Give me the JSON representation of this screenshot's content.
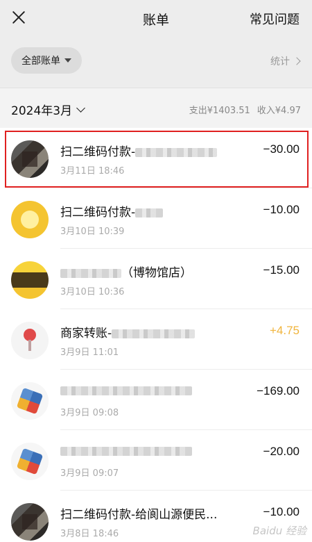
{
  "navbar": {
    "title": "账单",
    "faq_label": "常见问题"
  },
  "filter": {
    "chip_label": "全部账单",
    "stats_label": "统计"
  },
  "month": {
    "label": "2024年3月",
    "expense": "支出¥1403.51",
    "income": "收入¥4.97"
  },
  "transactions": [
    {
      "title": "扫二维码付款-",
      "time": "3月11日 18:46",
      "amount": "−30.00",
      "type": "expense",
      "avatar": "photo-avatar"
    },
    {
      "title": "扫二维码付款-",
      "time": "3月10日 10:39",
      "amount": "−10.00",
      "type": "expense",
      "avatar": "yellow-avatar"
    },
    {
      "title": "（博物馆店）",
      "time": "3月10日 10:36",
      "amount": "−15.00",
      "type": "expense",
      "avatar": "gold-avatar"
    },
    {
      "title": "商家转账-",
      "time": "3月9日 11:01",
      "amount": "+4.75",
      "type": "income",
      "avatar": "pin-avatar"
    },
    {
      "title": "",
      "time": "3月9日 09:08",
      "amount": "−169.00",
      "type": "expense",
      "avatar": "multi-avatar"
    },
    {
      "title": "",
      "time": "3月9日 09:07",
      "amount": "−20.00",
      "type": "expense",
      "avatar": "multi-avatar"
    },
    {
      "title": "扫二维码付款-给阆山源便民...",
      "time": "3月8日 18:46",
      "amount": "−10.00",
      "type": "expense",
      "avatar": "photo-avatar"
    }
  ],
  "colors": {
    "accent_income": "#f0b43c",
    "highlight_border": "#e02020",
    "header_bg": "#ededed"
  },
  "watermark": "Baidu 经验"
}
